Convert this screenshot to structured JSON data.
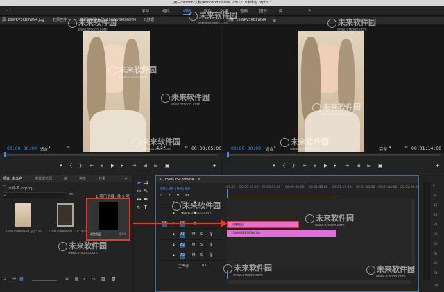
{
  "titlebar": {
    "path": "/用户/orsoon/文稿/Adobe/Premiere Pro/12.0/未命名.prproj *"
  },
  "workspaces": [
    "学习",
    "组件",
    "编辑",
    "颜色",
    "效果",
    "音频",
    "图形",
    "库"
  ],
  "source_panel": {
    "tabs": [
      "源: 15WKVSKB9WN4.jpg",
      "效果控件",
      "音频剪辑混合器: 15WKVSKB9WN4",
      "元数据"
    ],
    "timecode": "00:00:00:00",
    "fit": "适合",
    "ratio": "1/2",
    "duration": "00:00:05:00"
  },
  "program_panel": {
    "title": "节目: 15WKVSKB9WN4",
    "timecode": "00:00:00:00",
    "fit": "适合",
    "quality": "完整",
    "duration": "00:01:14:00"
  },
  "project_panel": {
    "tabs": [
      "项目: 未命名",
      "媒体浏览器",
      "库",
      "信息",
      "效果"
    ],
    "filename": "未命名.prproj",
    "selection": "1 项已选择, 共 3 项",
    "items": [
      {
        "name": "15WKVSKB9WN4.jpg",
        "dur": "5:00"
      },
      {
        "name": "15WKVSKB9WN4",
        "dur": "1:14:00"
      },
      {
        "name": "调整图层",
        "dur": "5:00"
      }
    ]
  },
  "timeline": {
    "title": "15WKVSKB9WN4",
    "timecode": "00:00:00:00",
    "ruler": [
      ":00:00",
      "00:00:15:00",
      "00:00:30:00",
      "00:00:45:00",
      "00:01:00:00",
      "00:01:15:00",
      "00:01:30:00",
      "00:01:45:00",
      "00:02:00:00"
    ],
    "tracks": [
      "V3",
      "V2",
      "V1",
      "A1",
      "A2",
      "A3"
    ],
    "master": "主声道",
    "master_val": "0.0",
    "clips": [
      {
        "name": "调整图层",
        "track": "V2"
      },
      {
        "name": "15WKVSKB9WN4.jpg",
        "track": "V1"
      }
    ]
  },
  "meter": {
    "labels": [
      "0",
      "-6",
      "-12",
      "-18",
      "-24",
      "-30",
      "-36",
      "-42",
      "-48",
      "-54"
    ],
    "unit": "dB"
  },
  "watermark": {
    "text": "未来软件园",
    "url": "www.orsoon.com"
  },
  "colors": {
    "accent": "#3d8ee8",
    "clip": "#e070d8",
    "highlight": "#e8352a",
    "bg": "#1e1e1e",
    "panel": "#232323"
  },
  "toolbar_icons": [
    "selection-tool",
    "track-select-tool",
    "ripple-edit-tool",
    "razor-tool",
    "slip-tool",
    "pen-tool",
    "hand-tool",
    "type-tool"
  ]
}
